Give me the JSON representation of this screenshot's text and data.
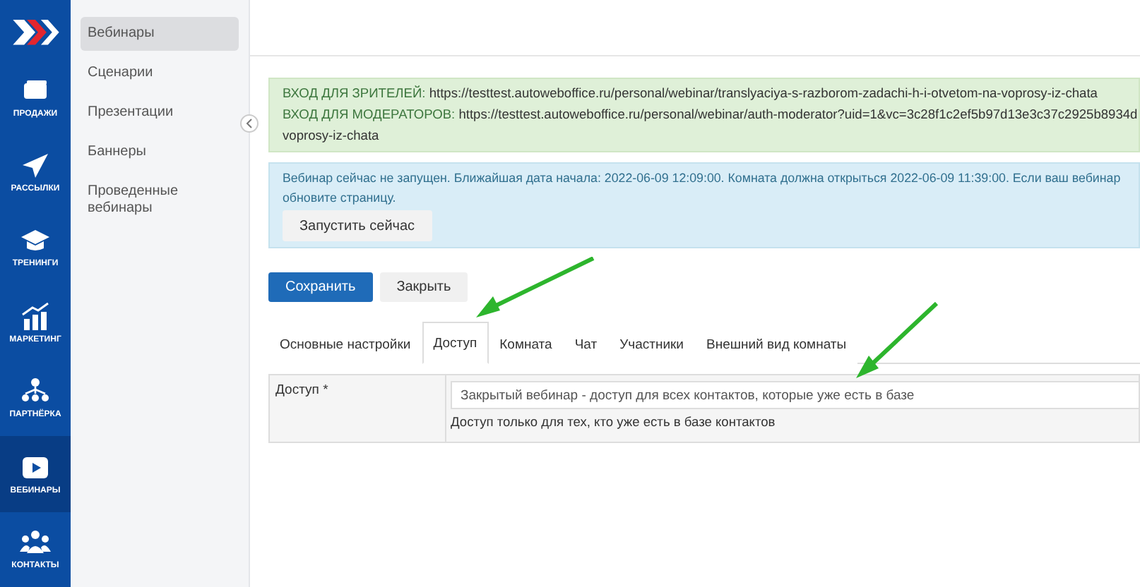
{
  "rail": {
    "items": [
      {
        "label": "ПРОДАЖИ",
        "kind": "card",
        "selected": false
      },
      {
        "label": "РАССЫЛКИ",
        "kind": "plane",
        "selected": false
      },
      {
        "label": "ТРЕНИНГИ",
        "kind": "cap",
        "selected": false
      },
      {
        "label": "МАРКЕТИНГ",
        "kind": "chart",
        "selected": false
      },
      {
        "label": "ПАРТНЁРКА",
        "kind": "tree",
        "selected": false
      },
      {
        "label": "ВЕБИНАРЫ",
        "kind": "play",
        "selected": true
      },
      {
        "label": "КОНТАКТЫ",
        "kind": "people",
        "selected": false
      }
    ]
  },
  "sidebar": {
    "items": [
      {
        "label": "Вебинары",
        "selected": true
      },
      {
        "label": "Сценарии",
        "selected": false
      },
      {
        "label": "Презентации",
        "selected": false
      },
      {
        "label": "Баннеры",
        "selected": false
      },
      {
        "label": "Проведенные вебинары",
        "selected": false
      }
    ]
  },
  "links_alert": {
    "lines": [
      {
        "label": "ВХОД ДЛЯ ЗРИТЕЛЕЙ:",
        "url": "https://testtest.autowebоffice.ru/personal/webinar/translyaciya-s-razborom-zadachi-h-i-otvetom-na-voprosy-iz-chata"
      },
      {
        "label": "ВХОД ДЛЯ МОДЕРАТОРОВ:",
        "url": "https://testtest.autoweboffice.ru/personal/webinar/auth-moderator?uid=1&vc=3c28f1c2ef5b97d13e3c37c2925b8934d"
      }
    ],
    "continuation": "voprosy-iz-chata"
  },
  "status_alert": {
    "lines": [
      "Вебинар сейчас не запущен. Ближайшая дата начала: 2022-06-09 12:09:00. Комната должна открыться 2022-06-09 11:39:00. Если ваш вебинар",
      "обновите страницу."
    ],
    "button": "Запустить сейчас"
  },
  "actions": {
    "save": "Сохранить",
    "close": "Закрыть"
  },
  "tabs": [
    {
      "label": "Основные настройки",
      "selected": false
    },
    {
      "label": "Доступ",
      "selected": true
    },
    {
      "label": "Комната",
      "selected": false
    },
    {
      "label": "Чат",
      "selected": false
    },
    {
      "label": "Участники",
      "selected": false
    },
    {
      "label": "Внешний вид комнаты",
      "selected": false
    }
  ],
  "form": {
    "label": "Доступ *",
    "value": "Закрытый вебинар - доступ для всех контактов, которые уже есть в базе",
    "help": "Доступ только для тех, кто уже есть в базе контактов"
  }
}
